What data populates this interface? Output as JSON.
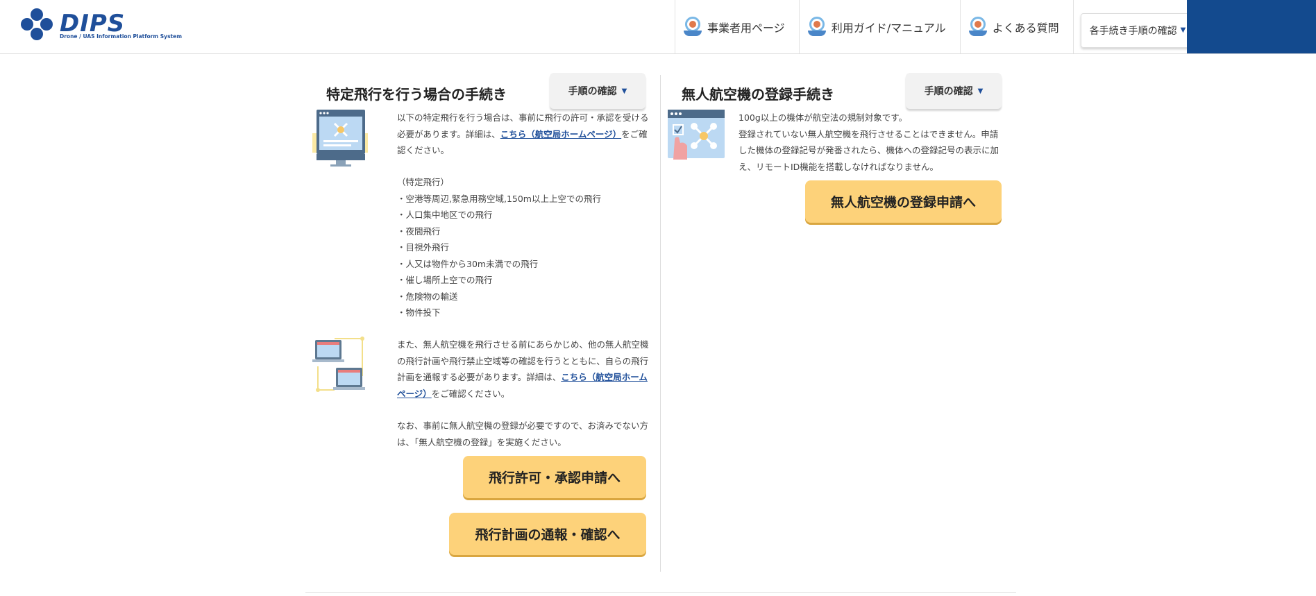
{
  "header": {
    "logo_word": "DIPS",
    "logo_sub": "Drone / UAS Information Platform System",
    "nav": [
      {
        "label": "事業者用ページ"
      },
      {
        "label": "利用ガイド/マニュアル"
      },
      {
        "label": "よくある質問"
      }
    ],
    "dropdown_label": "各手続き手順の確認"
  },
  "left": {
    "title": "特定飛行を行う場合の手続き",
    "proc_button": "手順の確認",
    "intro_pre": "以下の特定飛行を行う場合は、事前に飛行の許可・承認を受ける必要があります。詳細は、",
    "intro_link": "こちら（航空局ホームページ）",
    "intro_post": "をご確認ください。",
    "list_heading": "（特定飛行）",
    "list": [
      "・空港等周辺,緊急用務空域,150m以上上空での飛行",
      "・人口集中地区での飛行",
      "・夜間飛行",
      "・目視外飛行",
      "・人又は物件から30m未満での飛行",
      "・催し場所上空での飛行",
      "・危険物の輸送",
      "・物件投下"
    ],
    "plan_pre": "また、無人航空機を飛行させる前にあらかじめ、他の無人航空機の飛行計画や飛行禁止空域等の確認を行うとともに、自らの飛行計画を通報する必要があります。詳細は、",
    "plan_link": "こちら（航空局ホームページ）",
    "plan_post": "をご確認ください。",
    "note": "なお、事前に無人航空機の登録が必要ですので、お済みでない方は、「無人航空機の登録」を実施ください。",
    "cta1": "飛行許可・承認申請へ",
    "cta2": "飛行計画の通報・確認へ"
  },
  "right": {
    "title": "無人航空機の登録手続き",
    "proc_button": "手順の確認",
    "line1": "100g以上の機体が航空法の規制対象です。",
    "line2": "登録されていない無人航空機を飛行させることはできません。申請した機体の登録記号が発番されたら、機体への登録記号の表示に加え、リモートID機能を搭載しなければなりません。",
    "cta": "無人航空機の登録申請へ"
  }
}
